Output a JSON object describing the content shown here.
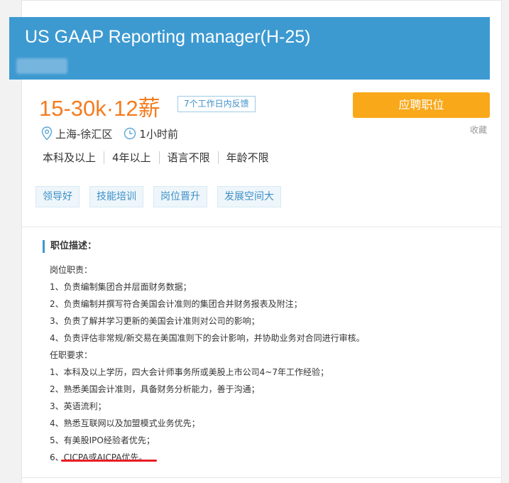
{
  "job": {
    "title": "US GAAP Reporting manager(H-25)",
    "salary": "15-30k·12薪",
    "feedback_badge": "7个工作日内反馈",
    "apply_label": "应聘职位",
    "favorite_label": "收藏",
    "location": "上海-徐汇区",
    "posted": "1小时前",
    "requirements": [
      "本科及以上",
      "4年以上",
      "语言不限",
      "年龄不限"
    ],
    "tags": [
      "领导好",
      "技能培训",
      "岗位晋升",
      "发展空间大"
    ]
  },
  "description": {
    "title": "职位描述：",
    "lines": [
      "岗位职责：",
      "1、负责编制集团合并层面财务数据；",
      "2、负责编制并撰写符合美国会计准则的集团合并财务报表及附注；",
      "3、负责了解并学习更新的美国会计准则对公司的影响；",
      "4、负责评估非常规/新交易在美国准则下的会计影响，并协助业务对合同进行审核。",
      "任职要求：",
      "1、本科及以上学历，四大会计师事务所或美股上市公司4~7年工作经验；",
      "2、熟悉美国会计准则，具备财务分析能力，善于沟通；",
      "3、英语流利；",
      "4、熟悉互联网以及加盟模式业务优先；",
      "5、有美股IPO经验者优先；",
      "6、CICPA或AICPA优先。"
    ]
  },
  "icons": {
    "location": "location-pin-icon",
    "time": "clock-icon"
  },
  "colors": {
    "header": "#3d9ad1",
    "salary": "#f47c20",
    "apply_button": "#f9a81a",
    "tag_text": "#3d8fc6",
    "highlight_underline": "#e81e25"
  }
}
